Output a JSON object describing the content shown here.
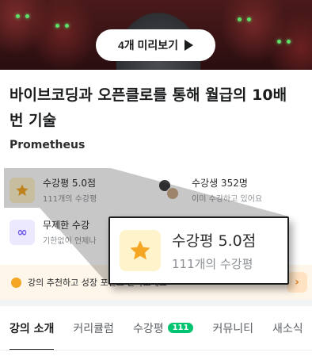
{
  "hero": {
    "preview_button_label": "4개 미리보기"
  },
  "course": {
    "title": "바이브코딩과 오픈클로를 통해 월급의 10배 번 기술",
    "author": "Prometheus"
  },
  "stats": {
    "rating": {
      "title": "수강평 5.0점",
      "sub": "111개의 수강평"
    },
    "students": {
      "title": "수강생 352명",
      "sub": "이미 수강하고 있어요"
    },
    "unlimited": {
      "title": "무제한 수강",
      "sub": "기한없이 언제나"
    }
  },
  "banner": {
    "text": "강의 추천하고 성장 포인트 받아보세요"
  },
  "tabs": [
    {
      "label": "강의 소개"
    },
    {
      "label": "커리큘럼"
    },
    {
      "label": "수강평",
      "badge": "111"
    },
    {
      "label": "커뮤니티"
    },
    {
      "label": "새소식"
    }
  ],
  "zoom": {
    "title": "수강평 5.0점",
    "sub": "111개의 수강평"
  },
  "colors": {
    "accent_green": "#00c471",
    "star": "#f5a623"
  }
}
